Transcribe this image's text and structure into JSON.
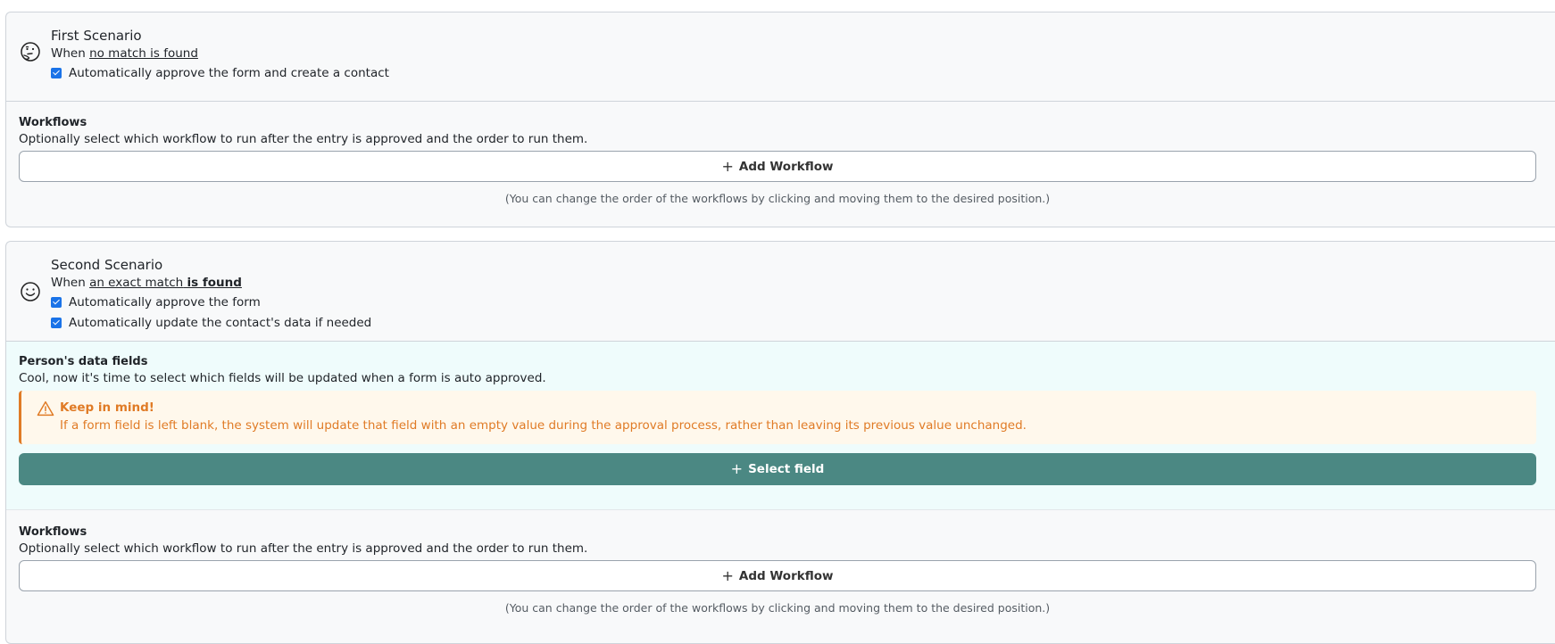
{
  "scenario1": {
    "title": "First Scenario",
    "sub_prefix": "When ",
    "sub_link": "no match is found",
    "checks": [
      {
        "label": "Automatically approve the form and create a contact",
        "checked": true
      }
    ],
    "workflows": {
      "title": "Workflows",
      "desc": "Optionally select which workflow to run after the entry is approved and the order to run them.",
      "button": "Add Workflow",
      "hint": "(You can change the order of the workflows by clicking and moving them to the desired position.)"
    }
  },
  "scenario2": {
    "title": "Second Scenario",
    "sub_prefix": "When ",
    "sub_link": "an exact match",
    "sub_bold": "is found",
    "checks": [
      {
        "label": "Automatically approve the form",
        "checked": true
      },
      {
        "label": "Automatically update the contact's data if needed",
        "checked": true
      }
    ],
    "fields": {
      "title": "Person's data fields",
      "desc": "Cool, now it's time to select which fields will be updated when a form is auto approved.",
      "alert_title": "Keep in mind!",
      "alert_text": "If a form field is left blank, the system will update that field with an empty value during the approval process, rather than leaving its previous value unchanged.",
      "button": "Select field"
    },
    "workflows": {
      "title": "Workflows",
      "desc": "Optionally select which workflow to run after the entry is approved and the order to run them.",
      "button": "Add Workflow",
      "hint": "(You can change the order of the workflows by clicking and moving them to the desired position.)"
    }
  },
  "icons": {
    "scenario1": "thinking-face-icon",
    "scenario2": "smiling-face-icon",
    "alert": "warning-triangle-icon",
    "add": "plus-icon"
  },
  "colors": {
    "checkbox": "#1a73e8",
    "primary_button": "#4b8883",
    "alert": "#e07b26",
    "fields_bg": "#effcfc"
  }
}
